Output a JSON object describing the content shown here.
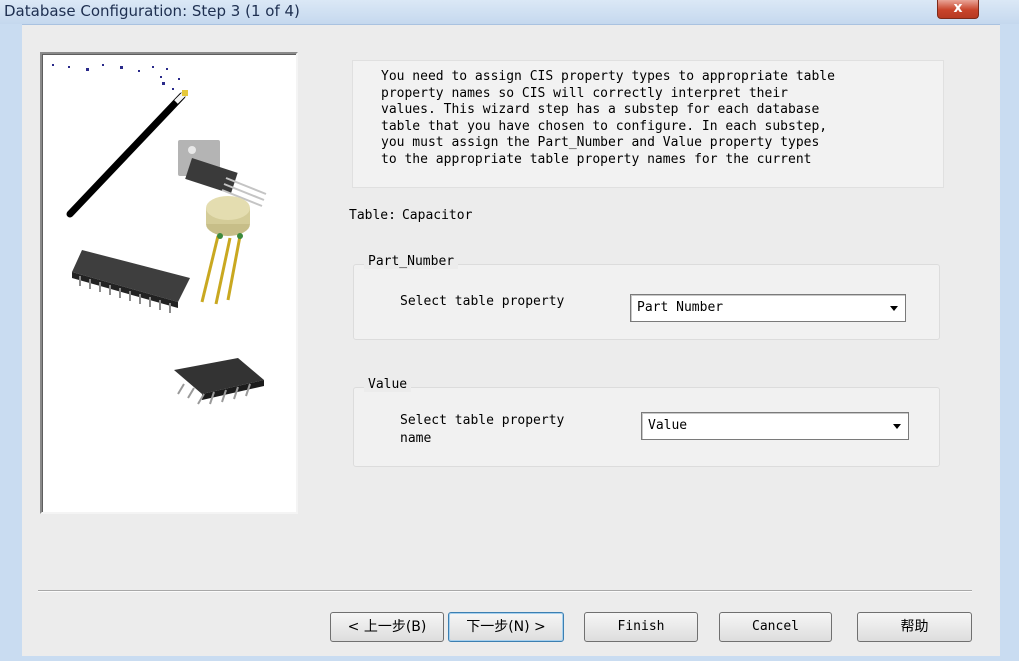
{
  "window": {
    "title": "Database Configuration: Step 3 (1 of 4)",
    "close_glyph": "x"
  },
  "description": "You need to assign CIS property types to appropriate table\nproperty names so CIS will correctly interpret their\nvalues. This wizard step has a substep for each database\ntable that you have chosen to configure. In each substep,\nyou must assign the Part_Number and Value property types\nto the appropriate table property names for the current",
  "table": {
    "label": "Table:",
    "value": "Capacitor"
  },
  "part_number_group": {
    "legend": "Part_Number",
    "field_label": "Select table property",
    "selected": "Part Number"
  },
  "value_group": {
    "legend": "Value",
    "field_label": "Select table property\nname",
    "selected": "Value"
  },
  "buttons": {
    "back": "< 上一步(B)",
    "next": "下一步(N) >",
    "finish": "Finish",
    "cancel": "Cancel",
    "help": "帮助"
  },
  "icons": {
    "close": "close-icon",
    "dropdown": "chevron-down-icon",
    "illustration": "wand-and-components-illustration"
  },
  "colors": {
    "title_bar": "#c5d8ee",
    "close_button": "#c8442b",
    "dialog_background": "#ececec"
  }
}
